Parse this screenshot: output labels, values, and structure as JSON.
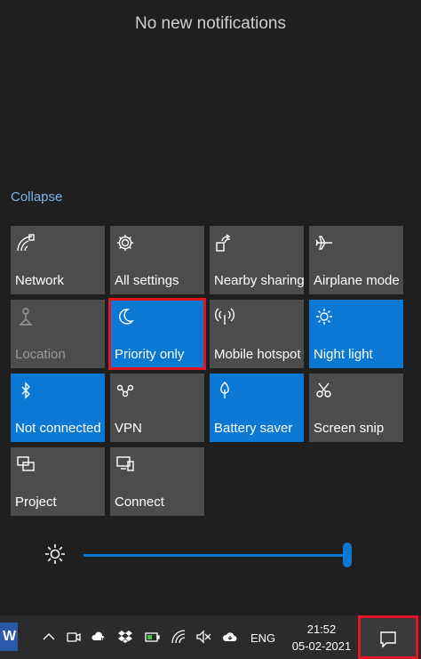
{
  "notifications": {
    "title": "No new notifications"
  },
  "collapse_label": "Collapse",
  "tiles": [
    {
      "label": "Network",
      "icon": "network-icon",
      "state": "off"
    },
    {
      "label": "All settings",
      "icon": "gear-icon",
      "state": "off"
    },
    {
      "label": "Nearby sharing",
      "icon": "nearby-sharing-icon",
      "state": "off"
    },
    {
      "label": "Airplane mode",
      "icon": "airplane-icon",
      "state": "off"
    },
    {
      "label": "Location",
      "icon": "location-icon",
      "state": "disabled"
    },
    {
      "label": "Priority only",
      "icon": "moon-icon",
      "state": "on",
      "highlighted": true
    },
    {
      "label": "Mobile hotspot",
      "icon": "hotspot-icon",
      "state": "off"
    },
    {
      "label": "Night light",
      "icon": "night-light-icon",
      "state": "on"
    },
    {
      "label": "Not connected",
      "icon": "bluetooth-icon",
      "state": "on"
    },
    {
      "label": "VPN",
      "icon": "vpn-icon",
      "state": "off"
    },
    {
      "label": "Battery saver",
      "icon": "battery-saver-icon",
      "state": "on"
    },
    {
      "label": "Screen snip",
      "icon": "screen-snip-icon",
      "state": "off"
    },
    {
      "label": "Project",
      "icon": "project-icon",
      "state": "off"
    },
    {
      "label": "Connect",
      "icon": "connect-icon",
      "state": "off"
    }
  ],
  "brightness": {
    "level": 1.0
  },
  "taskbar": {
    "app_letter": "W",
    "language": "ENG",
    "time": "21:52",
    "date": "05-02-2021"
  },
  "colors": {
    "accent": "#0b78d4",
    "tile_off": "#4c4c4c",
    "highlight": "#e01622",
    "background": "#1f1f1f"
  }
}
